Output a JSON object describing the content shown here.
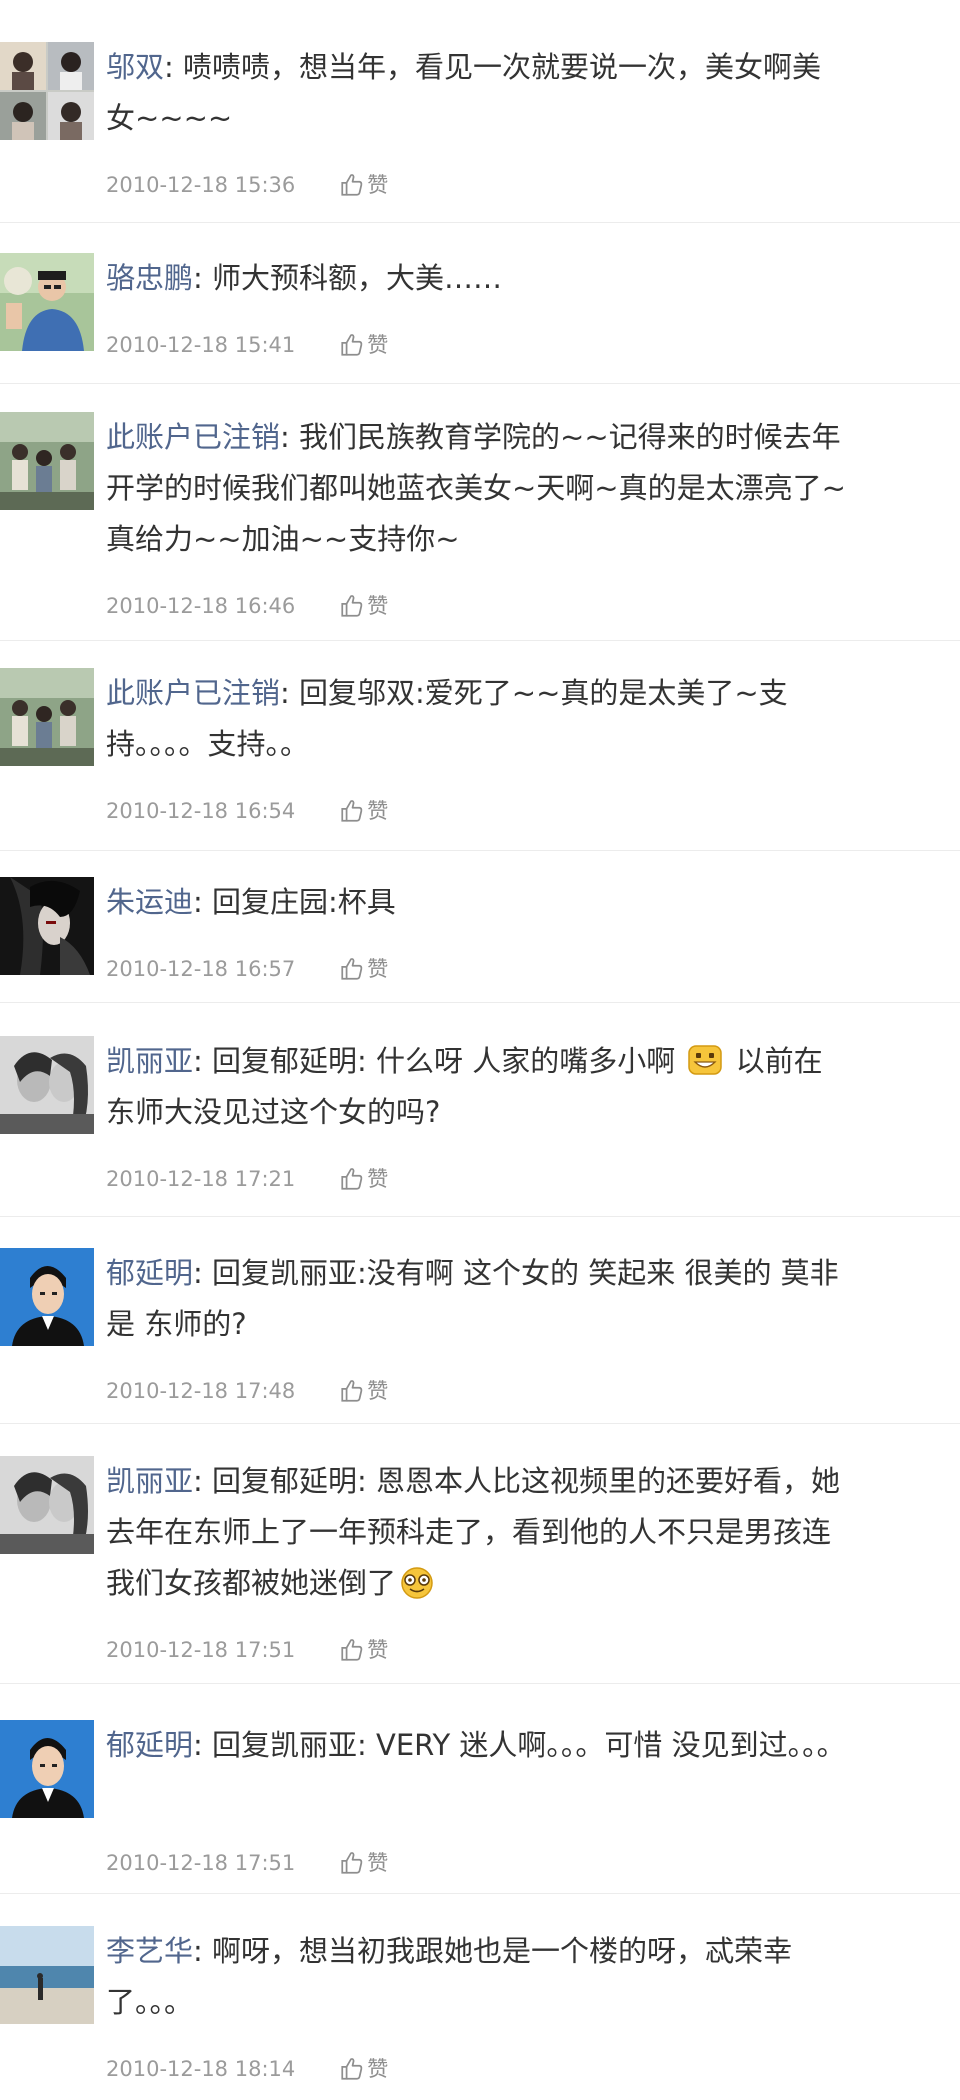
{
  "like_label": "赞",
  "colors": {
    "username": "#51668d",
    "text": "#333333",
    "time": "#9b9b9b",
    "separator": "#ececec"
  },
  "comments": [
    {
      "avatar": "portrait-collage",
      "user": "邬双",
      "sep": ":",
      "text": " 啧啧啧，想当年，看见一次就要说一次，美女啊美女~~~~",
      "time": "2010-12-18 15:36"
    },
    {
      "avatar": "man-outdoors",
      "user": "骆忠鹏",
      "sep": ":",
      "text": " 师大预科额，大美……",
      "time": "2010-12-18 15:41"
    },
    {
      "avatar": "group-photo",
      "user": "此账户已注销",
      "sep": ":",
      "text": " 我们民族教育学院的~~记得来的时候去年开学的时候我们都叫她蓝衣美女~天啊~真的是太漂亮了~真给力~~加油~~支持你~",
      "time": "2010-12-18 16:46"
    },
    {
      "avatar": "group-photo",
      "user": "此账户已注销",
      "sep": ":",
      "text": " 回复邬双:爱死了~~真的是太美了~支持。。。。支持。。",
      "time": "2010-12-18 16:54"
    },
    {
      "avatar": "dark-anime",
      "user": "朱运迪",
      "sep": ":",
      "text": " 回复庄园:杯具",
      "time": "2010-12-18 16:57"
    },
    {
      "avatar": "couple-bw",
      "user": "凯丽亚",
      "sep": ":",
      "text_before": " 回复郁延明: 什么呀 人家的嘴多小啊 ",
      "emoji": "grin-emoji",
      "text_after": " 以前在东师大没见过这个女的吗?",
      "time": "2010-12-18 17:21"
    },
    {
      "avatar": "id-photo-boy",
      "user": "郁延明",
      "sep": ":",
      "text": " 回复凯丽亚:没有啊 这个女的 笑起来 很美的 莫非是 东师的?",
      "time": "2010-12-18 17:48"
    },
    {
      "avatar": "couple-bw",
      "user": "凯丽亚",
      "sep": ":",
      "text_before": " 回复郁延明: 恩恩本人比这视频里的还要好看，她去年在东师上了一年预科走了，看到他的人不只是男孩连我们女孩都被她迷倒了",
      "emoji": "dizzy-emoji",
      "text_after": "",
      "time": "2010-12-18 17:51"
    },
    {
      "avatar": "id-photo-boy",
      "user": "郁延明",
      "sep": ":",
      "text": " 回复凯丽亚: VERY 迷人啊。。。可惜 没见到过。。。",
      "time": "2010-12-18 17:51"
    },
    {
      "avatar": "beach-scene",
      "user": "李艺华",
      "sep": ":",
      "text": " 啊呀，想当初我跟她也是一个楼的呀，忒荣幸了。。。",
      "time": "2010-12-18 18:14"
    }
  ]
}
